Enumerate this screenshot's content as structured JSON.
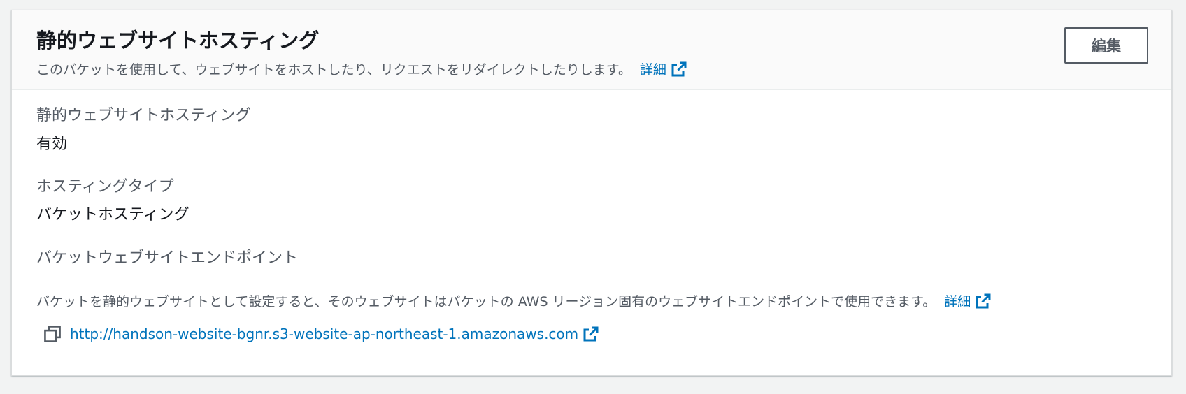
{
  "header": {
    "title": "静的ウェブサイトホスティング",
    "description": "このバケットを使用して、ウェブサイトをホストしたり、リクエストをリダイレクトしたりします。",
    "learn_more": "詳細",
    "edit_label": "編集"
  },
  "fields": {
    "static_hosting": {
      "label": "静的ウェブサイトホスティング",
      "value": "有効"
    },
    "hosting_type": {
      "label": "ホスティングタイプ",
      "value": "バケットホスティング"
    },
    "endpoint": {
      "label": "バケットウェブサイトエンドポイント",
      "description": "バケットを静的ウェブサイトとして設定すると、そのウェブサイトはバケットの AWS リージョン固有のウェブサイトエンドポイントで使用できます。",
      "learn_more": "詳細",
      "url": "http://handson-website-bgnr.s3-website-ap-northeast-1.amazonaws.com"
    }
  },
  "icons": {
    "external": "external-link-icon",
    "copy": "copy-icon"
  },
  "colors": {
    "link": "#0073bb",
    "text": "#16191f",
    "secondary_text": "#545b64",
    "header_bg": "#fafafa",
    "page_bg": "#f2f3f3"
  }
}
